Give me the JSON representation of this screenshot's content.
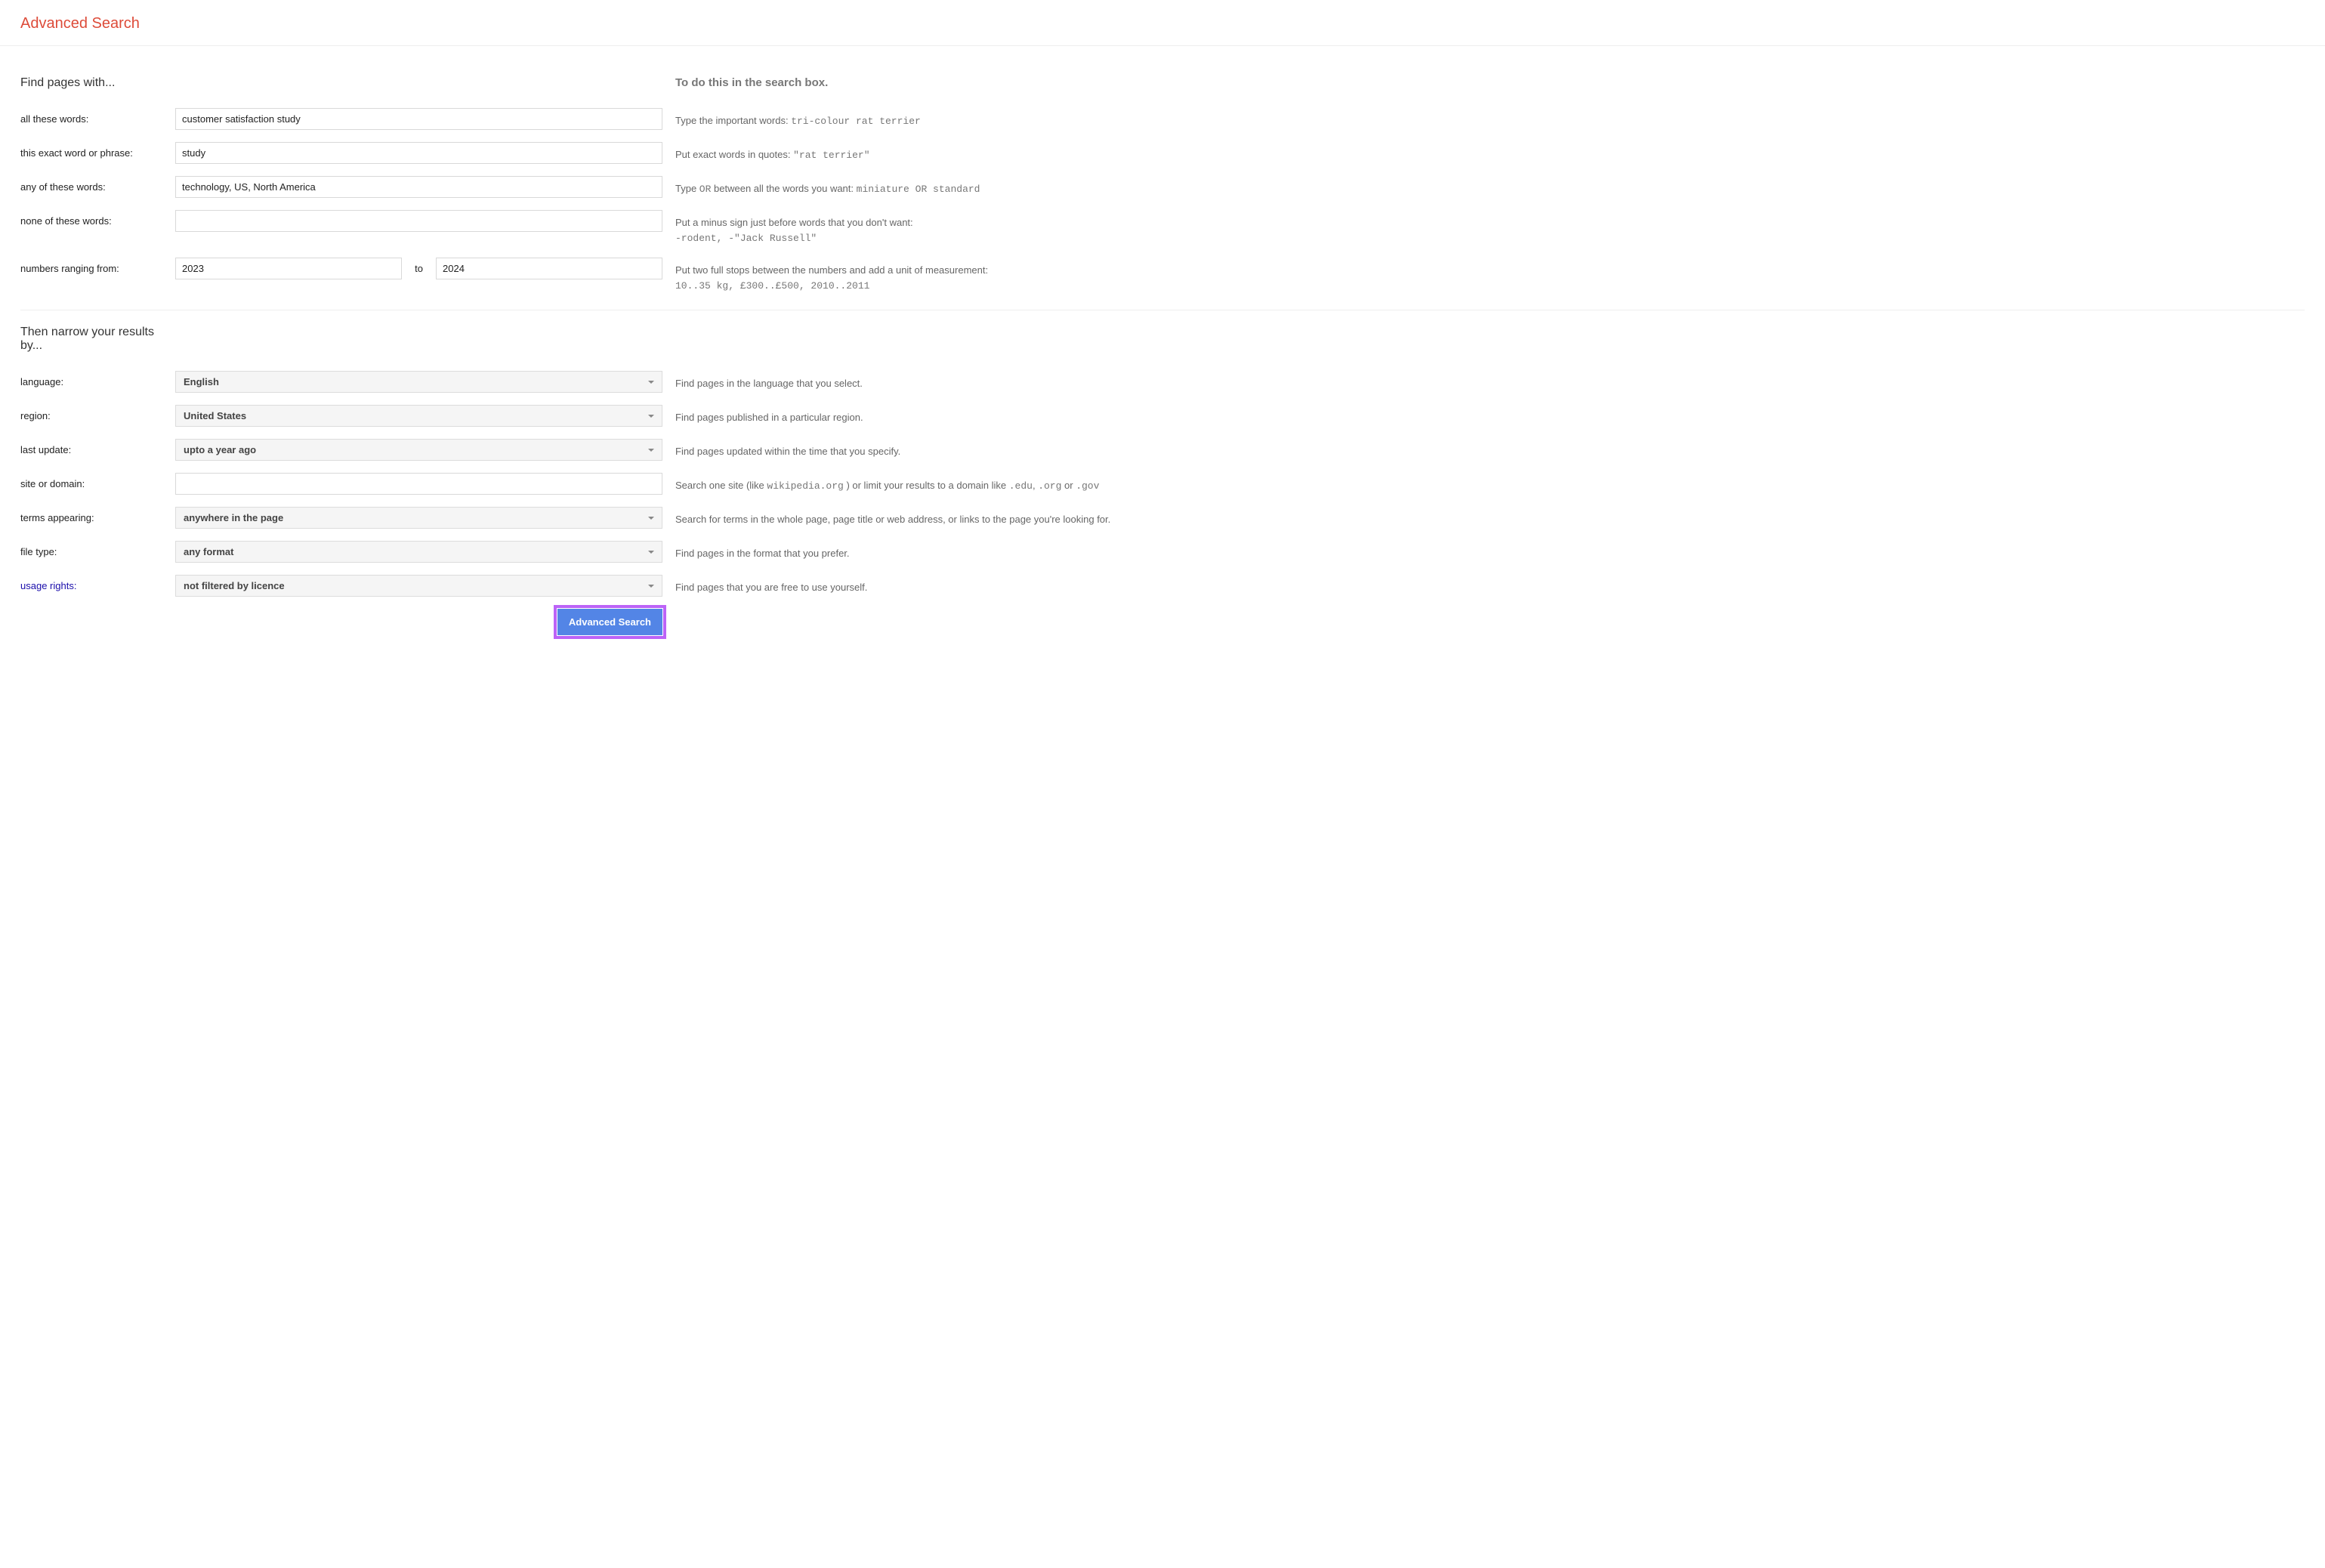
{
  "header": {
    "title": "Advanced Search"
  },
  "section1": {
    "heading": "Find pages with...",
    "tipsHeading": "To do this in the search box."
  },
  "fields": {
    "allWords": {
      "label": "all these words:",
      "value": "customer satisfaction study",
      "tip": "Type the important words: ",
      "tipCode": "tri-colour rat terrier"
    },
    "exactPhrase": {
      "label": "this exact word or phrase:",
      "value": "study",
      "tip": "Put exact words in quotes: ",
      "tipCode": "\"rat terrier\""
    },
    "anyWords": {
      "label": "any of these words:",
      "value": "technology, US, North America",
      "tipPre": "Type ",
      "tipCode1": "OR",
      "tipMid": " between all the words you want: ",
      "tipCode2": "miniature OR standard"
    },
    "noneWords": {
      "label": "none of these words:",
      "value": "",
      "tip": "Put a minus sign just before words that you don't want: ",
      "tipCode": "-rodent, -\"Jack Russell\""
    },
    "numRange": {
      "label": "numbers ranging from:",
      "from": "2023",
      "to": "2024",
      "toLabel": "to",
      "tip": "Put two full stops between the numbers and add a unit of measurement: ",
      "tipCode": "10..35 kg, £300..£500, 2010..2011"
    }
  },
  "section2": {
    "heading": "Then narrow your results by..."
  },
  "narrow": {
    "language": {
      "label": "language:",
      "value": "English",
      "tip": "Find pages in the language that you select."
    },
    "region": {
      "label": "region:",
      "value": "United States",
      "tip": "Find pages published in a particular region."
    },
    "lastUpdate": {
      "label": "last update:",
      "value": "upto a year ago",
      "tip": "Find pages updated within the time that you specify."
    },
    "site": {
      "label": "site or domain:",
      "value": "",
      "tipPre": "Search one site (like ",
      "tipCode1": "wikipedia.org",
      "tipMid": " ) or limit your results to a domain like ",
      "tipCode2": ".edu",
      "tipComma": ", ",
      "tipCode3": ".org",
      "tipOr": " or ",
      "tipCode4": ".gov"
    },
    "terms": {
      "label": "terms appearing:",
      "value": "anywhere in the page",
      "tip": "Search for terms in the whole page, page title or web address, or links to the page you're looking for."
    },
    "fileType": {
      "label": "file type:",
      "value": "any format",
      "tip": "Find pages in the format that you prefer."
    },
    "usageRights": {
      "label": "usage rights:",
      "value": "not filtered by licence",
      "tip": "Find pages that you are free to use yourself."
    }
  },
  "button": {
    "label": "Advanced Search"
  }
}
